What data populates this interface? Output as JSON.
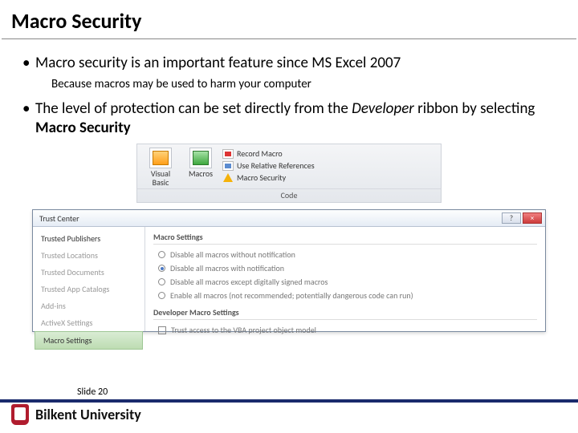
{
  "title": "Macro Security",
  "bullets": {
    "b1": "Macro security is an important feature since MS Excel 2007",
    "b1_sub": "Because macros may be used to harm your computer",
    "b2_pre": "The level of protection can be set directly from the ",
    "b2_dev": "Developer",
    "b2_mid": " ribbon by selecting ",
    "b2_ms": "Macro Security"
  },
  "ribbon": {
    "visual_basic": "Visual Basic",
    "macros": "Macros",
    "record": "Record Macro",
    "relative": "Use Relative References",
    "security": "Macro Security",
    "group": "Code"
  },
  "dialog": {
    "title": "Trust Center",
    "help": "?",
    "close": "×",
    "side": {
      "trusted_publishers": "Trusted Publishers",
      "trusted_locations": "Trusted Locations",
      "trusted_documents": "Trusted Documents",
      "trusted_app_catalogs": "Trusted App Catalogs",
      "addins": "Add-ins",
      "activex": "ActiveX Settings",
      "macro_settings": "Macro Settings"
    },
    "main": {
      "heading": "Macro Settings",
      "opt1": "Disable all macros without notification",
      "opt2": "Disable all macros with notification",
      "opt3": "Disable all macros except digitally signed macros",
      "opt4": "Enable all macros (not recommended; potentially dangerous code can run)",
      "dev_heading": "Developer Macro Settings",
      "dev_opt": "Trust access to the VBA project object model"
    }
  },
  "footer": {
    "slide": "Slide 20",
    "brand": "Bilkent University"
  }
}
